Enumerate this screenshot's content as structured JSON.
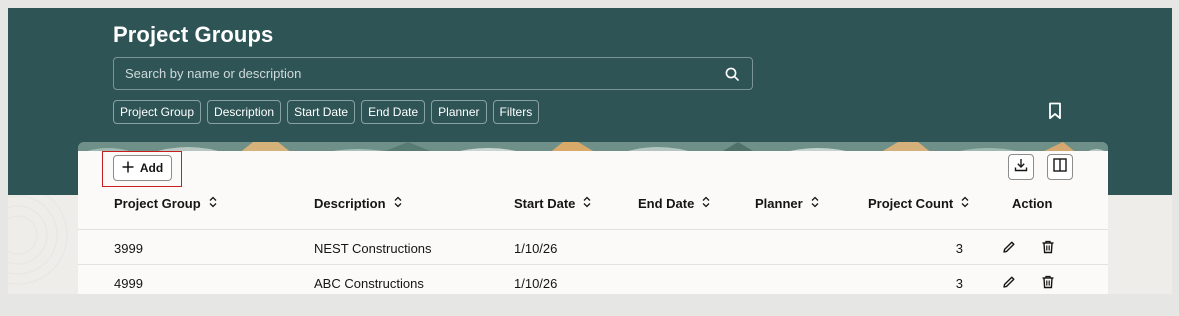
{
  "header": {
    "title": "Project Groups",
    "search_placeholder": "Search by name or description",
    "search_icon": "search-icon",
    "bookmark_icon": "bookmark-icon"
  },
  "filters": [
    "Project Group",
    "Description",
    "Start Date",
    "End Date",
    "Planner",
    "Filters"
  ],
  "toolbar": {
    "add_label": "Add",
    "add_icon": "plus-icon",
    "export_icon": "download-icon",
    "columns_icon": "columns-icon"
  },
  "table": {
    "columns": [
      "Project Group",
      "Description",
      "Start Date",
      "End Date",
      "Planner",
      "Project Count",
      "Action"
    ],
    "rows": [
      {
        "project_group": "3999",
        "description": "NEST Constructions",
        "start_date": "1/10/26",
        "end_date": "",
        "planner": "",
        "project_count": "3"
      },
      {
        "project_group": "4999",
        "description": "ABC Constructions",
        "start_date": "1/10/26",
        "end_date": "",
        "planner": "",
        "project_count": "3"
      }
    ],
    "row_actions": [
      "edit-icon",
      "delete-icon"
    ]
  },
  "colors": {
    "header_bg": "#2f5456",
    "highlight": "#c81e1e",
    "text": "#161513"
  }
}
